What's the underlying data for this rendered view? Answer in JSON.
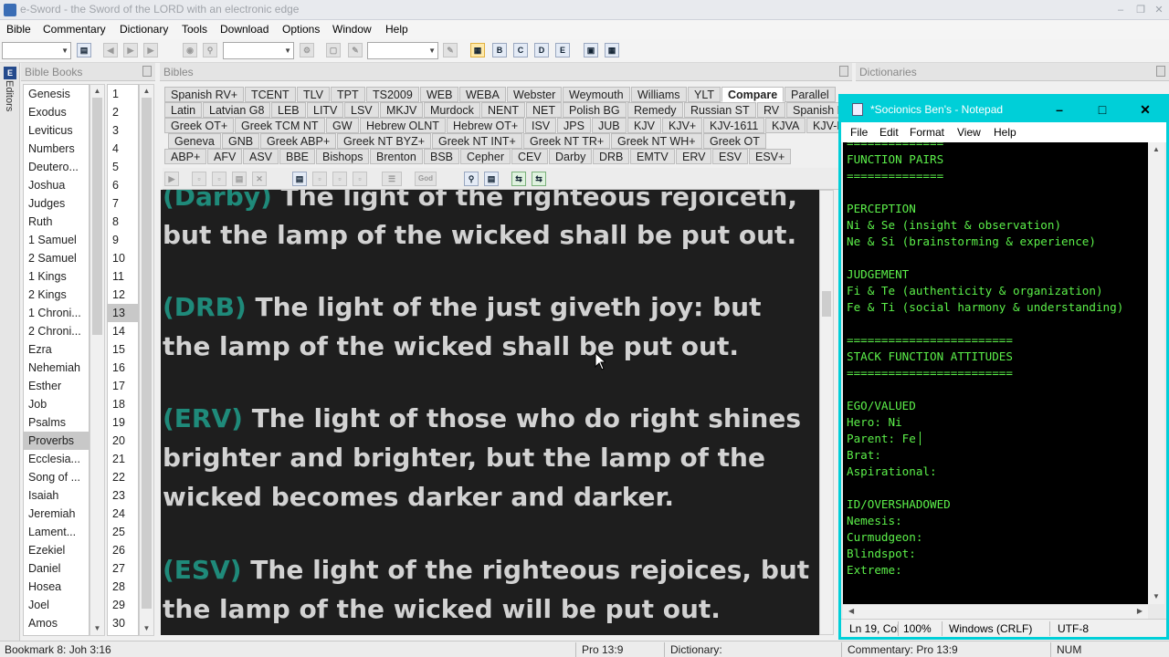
{
  "window": {
    "title": "e-Sword - the Sword of the LORD with an electronic edge"
  },
  "menu": [
    "Bible",
    "Commentary",
    "Dictionary",
    "Tools",
    "Download",
    "Options",
    "Window",
    "Help"
  ],
  "panels": {
    "editors": "Editors",
    "bible_books": "Bible Books",
    "bibles": "Bibles",
    "dictionaries": "Dictionaries"
  },
  "books": [
    "Genesis",
    "Exodus",
    "Leviticus",
    "Numbers",
    "Deutero...",
    "Joshua",
    "Judges",
    "Ruth",
    "1 Samuel",
    "2 Samuel",
    "1 Kings",
    "2 Kings",
    "1 Chroni...",
    "2 Chroni...",
    "Ezra",
    "Nehemiah",
    "Esther",
    "Job",
    "Psalms",
    "Proverbs",
    "Ecclesia...",
    "Song of ...",
    "Isaiah",
    "Jeremiah",
    "Lament...",
    "Ezekiel",
    "Daniel",
    "Hosea",
    "Joel",
    "Amos"
  ],
  "selected_book": "Proverbs",
  "chapters": [
    "1",
    "2",
    "3",
    "4",
    "5",
    "6",
    "7",
    "8",
    "9",
    "10",
    "11",
    "12",
    "13",
    "14",
    "15",
    "16",
    "17",
    "18",
    "19",
    "20",
    "21",
    "22",
    "23",
    "24",
    "25",
    "26",
    "27",
    "28",
    "29",
    "30"
  ],
  "selected_chapter": "13",
  "bible_tabs": [
    [
      "Spanish RV+",
      "TCENT",
      "TLV",
      "TPT",
      "TS2009",
      "WEB",
      "WEBA",
      "Webster",
      "Weymouth",
      "Williams",
      "YLT",
      "Compare",
      "Parallel"
    ],
    [
      "Latin",
      "Latvian G8",
      "LEB",
      "LITV",
      "LSV",
      "MKJV",
      "Murdock",
      "NENT",
      "NET",
      "Polish BG",
      "Remedy",
      "Russian ST",
      "RV",
      "Spanish RV"
    ],
    [
      "Greek OT+",
      "Greek TCM NT",
      "GW",
      "Hebrew OLNT",
      "Hebrew OT+",
      "ISV",
      "JPS",
      "JUB",
      "KJV",
      "KJV+",
      "KJV-1611",
      "KJVA",
      "KJV-BRG"
    ],
    [
      "Geneva",
      "GNB",
      "Greek ABP+",
      "Greek NT BYZ+",
      "Greek NT INT+",
      "Greek NT TR+",
      "Greek NT WH+",
      "Greek OT"
    ],
    [
      "ABP+",
      "AFV",
      "ASV",
      "BBE",
      "Bishops",
      "Brenton",
      "BSB",
      "Cepher",
      "CEV",
      "Darby",
      "DRB",
      "EMTV",
      "ERV",
      "ESV",
      "ESV+"
    ]
  ],
  "active_tab": "Compare",
  "verses": [
    {
      "label": "(Darby)",
      "text": "The light of the righteous rejoiceth, but the lamp of the wicked shall be put out."
    },
    {
      "label": "(DRB)",
      "text": "The light of the just giveth joy: but the lamp of the wicked shall be put out."
    },
    {
      "label": "(ERV)",
      "text": "The light of those who do right shines brighter and brighter, but the lamp of the wicked becomes darker and darker."
    },
    {
      "label": "(ESV)",
      "text": "The light of the righteous rejoices, but the lamp of the wicked will be put out."
    }
  ],
  "verse_lines": [
    {
      "label": "(Darby)",
      "rest": "  The light of the righteous rejoiceth,"
    },
    {
      "label": "",
      "rest": "but the lamp of the wicked shall be put out."
    },
    {
      "label": "(DRB)",
      "rest": "  The light of the just giveth joy: but"
    },
    {
      "label": "",
      "rest": "the lamp of the wicked shall be put out."
    },
    {
      "label": "(ERV)",
      "rest": "  The light of those who do right shines"
    },
    {
      "label": "",
      "rest": "brighter and brighter, but the lamp of the"
    },
    {
      "label": "",
      "rest": "wicked becomes darker and darker."
    },
    {
      "label": "(ESV)",
      "rest": "  The light of the righteous rejoices, but"
    },
    {
      "label": "",
      "rest": "the lamp of the wicked will be put out."
    }
  ],
  "notepad": {
    "title": "*Socionics Ben's - Notepad",
    "menu": [
      "File",
      "Edit",
      "Format",
      "View",
      "Help"
    ],
    "lines": [
      "==============",
      "FUNCTION PAIRS",
      "==============",
      "",
      "PERCEPTION",
      "Ni & Se (insight & observation)",
      "Ne & Si (brainstorming & experience)",
      "",
      "JUDGEMENT",
      "Fi & Te (authenticity & organization)",
      "Fe & Ti (social harmony & understanding)",
      "",
      "========================",
      "STACK FUNCTION ATTITUDES",
      "========================",
      "",
      "EGO/VALUED",
      "Hero: Ni",
      "Parent: Fe",
      "Brat:",
      "Aspirational:",
      "",
      "ID/OVERSHADOWED",
      "Nemesis:",
      "Curmudgeon:",
      "Blindspot:",
      "Extreme:"
    ],
    "status": {
      "position": "Ln 19, Col",
      "zoom": "100%",
      "line_ending": "Windows (CRLF)",
      "encoding": "UTF-8"
    }
  },
  "statusbar": {
    "bookmark": "Bookmark 8: Joh 3:16",
    "reference": "Pro 13:9",
    "dictionary": "Dictionary:",
    "commentary": "Commentary: Pro 13:9",
    "num": "NUM"
  },
  "colors": {
    "verse_label": "#1f8a7a",
    "notepad_accent": "#00cfd8",
    "notepad_text": "#5cf04a"
  }
}
